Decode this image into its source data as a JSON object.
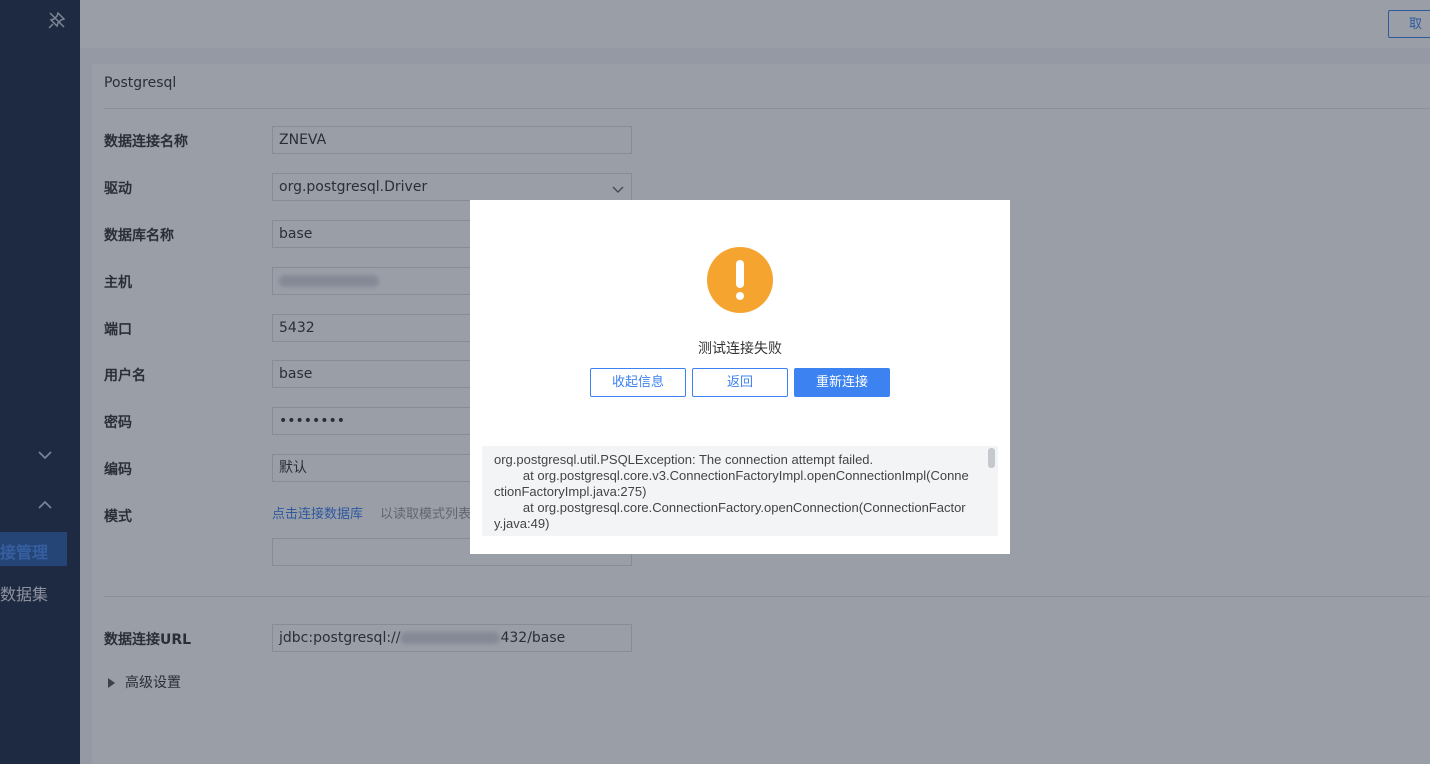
{
  "sidebar": {
    "active_item": "接管理",
    "item_dataset": "数据集"
  },
  "topbar": {
    "cancel_label": "取"
  },
  "form": {
    "section_title": "Postgresql",
    "fields": [
      {
        "label": "数据连接名称",
        "value": "ZNEVA"
      },
      {
        "label": "驱动",
        "value": "org.postgresql.Driver"
      },
      {
        "label": "数据库名称",
        "value": "base"
      },
      {
        "label": "主机",
        "value": ""
      },
      {
        "label": "端口",
        "value": "5432"
      },
      {
        "label": "用户名",
        "value": "base"
      },
      {
        "label": "密码",
        "value": "••••••••"
      },
      {
        "label": "编码",
        "value": "默认"
      },
      {
        "label": "模式",
        "link": "点击连接数据库",
        "hint": "以读取模式列表"
      }
    ],
    "url_label": "数据连接URL",
    "url_prefix": "jdbc:postgresql://",
    "url_suffix": "432/base",
    "advanced_label": "高级设置"
  },
  "modal": {
    "message": "测试连接失败",
    "buttons": {
      "collapse": "收起信息",
      "back": "返回",
      "reconnect": "重新连接"
    },
    "log": "org.postgresql.util.PSQLException: The connection attempt failed.\n        at org.postgresql.core.v3.ConnectionFactoryImpl.openConnectionImpl(ConnectionFactoryImpl.java:275)\n        at org.postgresql.core.ConnectionFactory.openConnection(ConnectionFactory.java:49)"
  },
  "colors": {
    "accent": "#3c82f0",
    "warning": "#f5a430",
    "sidebar": "#1e2d48"
  }
}
